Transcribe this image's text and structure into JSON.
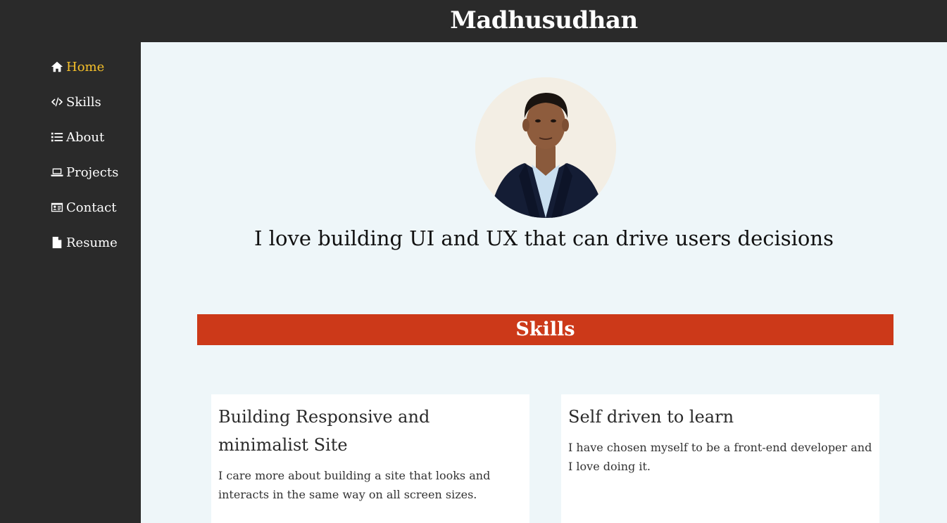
{
  "header": {
    "title": "Madhusudhan"
  },
  "sidebar": {
    "items": [
      {
        "label": "Home",
        "icon": "home-icon"
      },
      {
        "label": "Skills",
        "icon": "code-icon"
      },
      {
        "label": "About",
        "icon": "list-icon"
      },
      {
        "label": "Projects",
        "icon": "laptop-icon"
      },
      {
        "label": "Contact",
        "icon": "id-card-icon"
      },
      {
        "label": "Resume",
        "icon": "file-icon"
      }
    ],
    "active_color": "#f5c02a"
  },
  "hero": {
    "tagline": "I love building UI and UX that can drive users decisions"
  },
  "skills": {
    "heading": "Skills",
    "accent_color": "#cc3919",
    "cards": [
      {
        "title": "Building Responsive and minimalist Site",
        "text": "I care more about building a site that looks and interacts in the same way on all screen sizes."
      },
      {
        "title": "Self driven to learn",
        "text": "I have chosen myself to be a front-end developer and I love doing it."
      }
    ]
  }
}
